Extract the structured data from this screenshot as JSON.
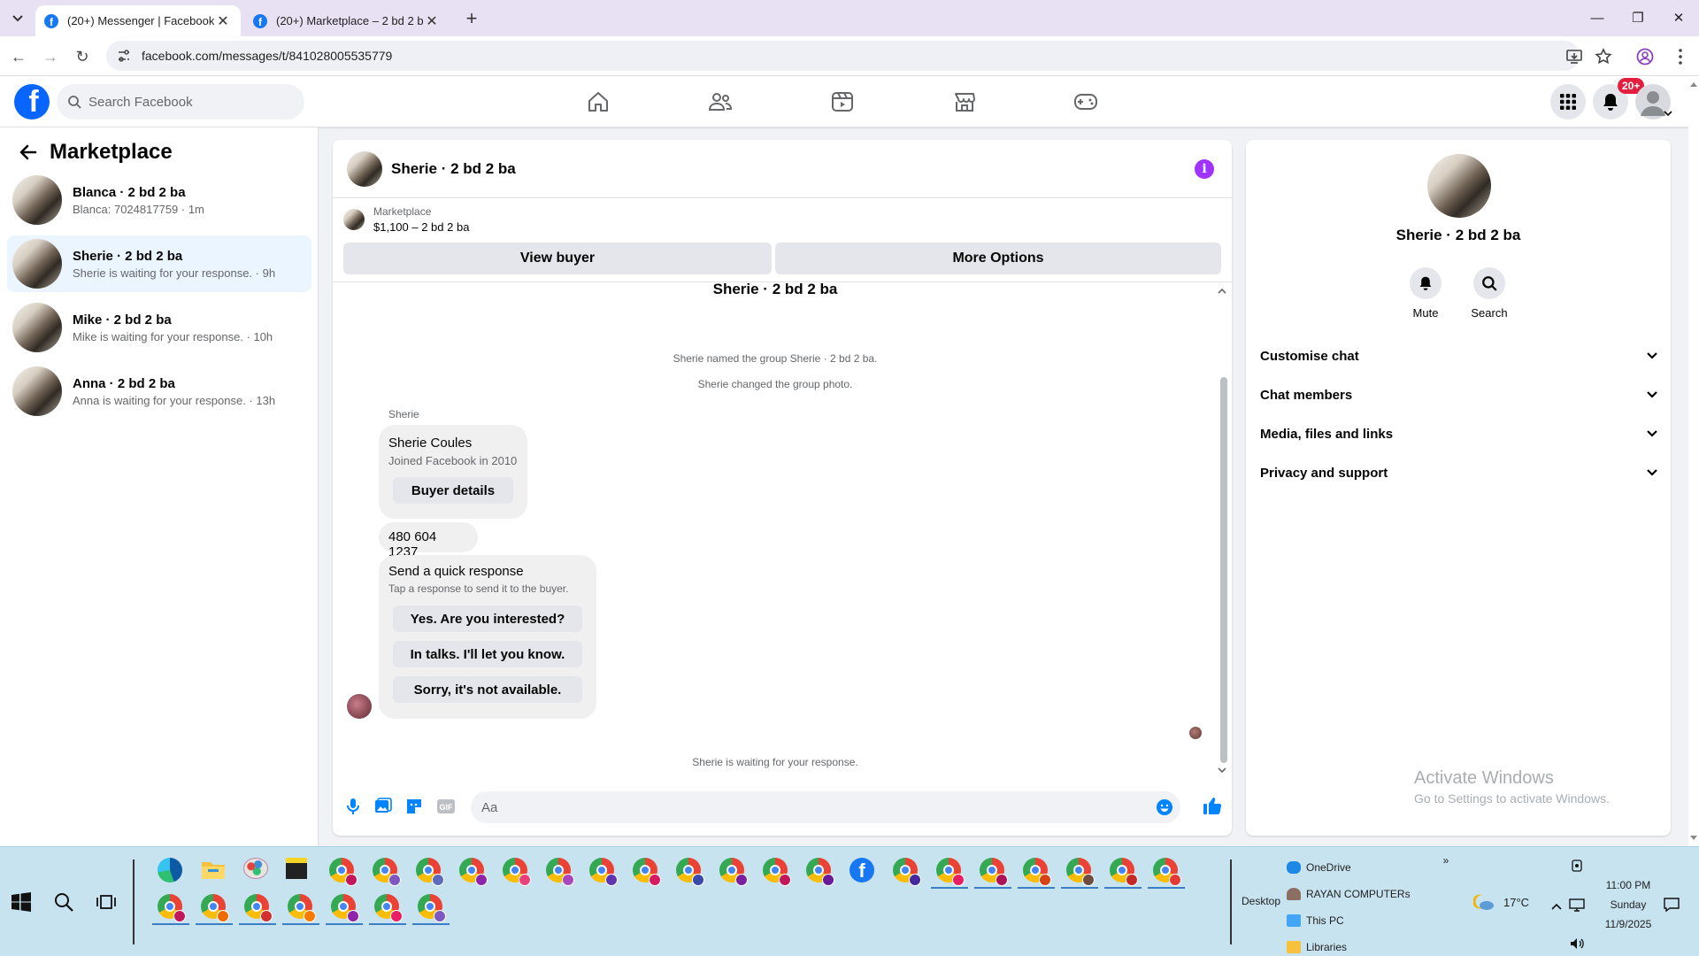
{
  "browser": {
    "tabs": [
      {
        "title": "(20+) Messenger | Facebook",
        "active": true
      },
      {
        "title": "(20+) Marketplace – 2 bd 2 ba",
        "active": false
      }
    ],
    "url": "facebook.com/messages/t/841028005535779"
  },
  "header": {
    "search_placeholder": "Search Facebook",
    "notification_count": "20+"
  },
  "sidebar": {
    "title": "Marketplace",
    "conversations": [
      {
        "name": "Blanca · 2 bd 2 ba",
        "snippet": "Blanca: 7024817759 · 1m",
        "active": false
      },
      {
        "name": "Sherie · 2 bd 2 ba",
        "snippet": "Sherie is waiting for your response. · 9h",
        "active": true
      },
      {
        "name": "Mike · 2 bd 2 ba",
        "snippet": "Mike is waiting for your response. · 10h",
        "active": false
      },
      {
        "name": "Anna · 2 bd 2 ba",
        "snippet": "Anna is waiting for your response. · 13h",
        "active": false
      }
    ]
  },
  "chat": {
    "title": "Sherie · 2 bd 2 ba",
    "listing_source": "Marketplace",
    "listing_text": "$1,100 – 2 bd 2 ba",
    "view_buyer_label": "View buyer",
    "more_options_label": "More Options",
    "thread_title": "Sherie · 2 bd 2 ba",
    "system_messages": [
      "Sherie named the group Sherie · 2 bd 2 ba.",
      "Sherie changed the group photo."
    ],
    "sender": "Sherie",
    "buyer_card": {
      "name": "Sherie Coules",
      "joined": "Joined Facebook in 2010",
      "button": "Buyer details"
    },
    "phone_message": "480 604 1237",
    "quick_response": {
      "title": "Send a quick response",
      "subtitle": "Tap a response to send it to the buyer.",
      "options": [
        "Yes. Are you interested?",
        "In talks. I'll let you know.",
        "Sorry, it's not available."
      ]
    },
    "waiting_status": "Sherie is waiting for your response.",
    "composer_placeholder": "Aa"
  },
  "right_panel": {
    "name": "Sherie · 2 bd 2 ba",
    "actions": [
      "Mute",
      "Search"
    ],
    "sections": [
      "Customise chat",
      "Chat members",
      "Media, files and links",
      "Privacy and support"
    ],
    "watermark_title": "Activate Windows",
    "watermark_sub": "Go to Settings to activate Windows."
  },
  "taskbar": {
    "desktop_label": "Desktop",
    "tray_items": [
      "OneDrive",
      "RAYAN COMPUTERs",
      "This PC",
      "Libraries"
    ],
    "temperature": "17°C",
    "time": "11:00 PM",
    "day": "Sunday",
    "date": "11/9/2025"
  },
  "colors": {
    "facebook_blue": "#0866ff",
    "active_conversation": "#ebf5ff",
    "info_purple": "#a033ff",
    "messenger_accent": "#0084ff"
  }
}
